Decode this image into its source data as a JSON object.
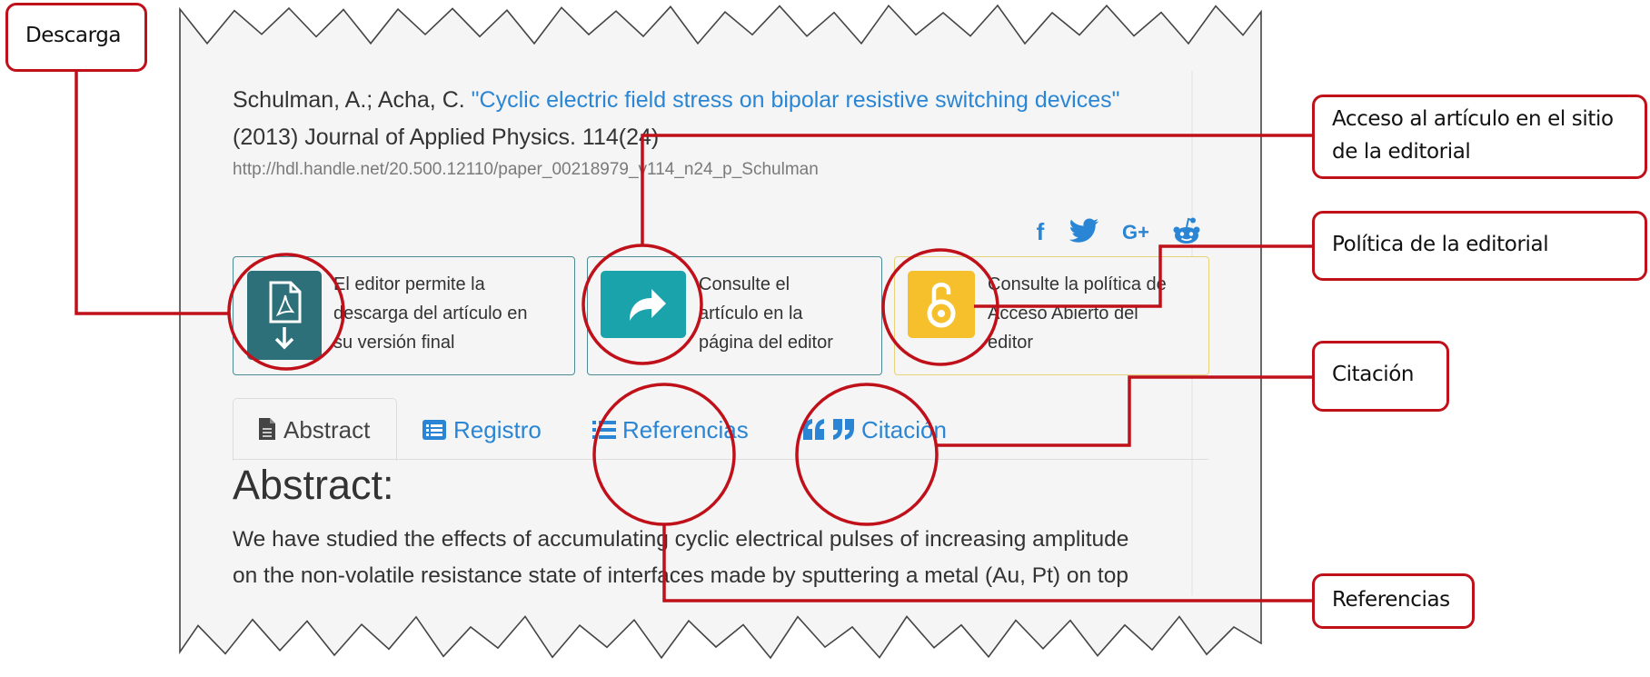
{
  "citation": {
    "authors": "Schulman, A.; Acha, C.",
    "title": "\"Cyclic electric field stress on bipolar resistive switching devices\"",
    "journal": "(2013) Journal of Applied Physics. 114(24)",
    "url": "http://hdl.handle.net/20.500.12110/paper_00218979_v114_n24_p_Schulman"
  },
  "social": {
    "facebook": "f",
    "twitter": "🐦",
    "googleplus": "G+",
    "reddit": "reddit"
  },
  "actions": {
    "download": {
      "line1": "El editor permite la",
      "line2": "descarga del artículo en",
      "line3": "su versión final",
      "icon": "pdf-download-icon",
      "color": "#2e7079"
    },
    "publisher": {
      "line1": "Consulte el",
      "line2": "artículo en la",
      "line3": "página del editor",
      "icon": "share-arrow-icon",
      "color": "#1ba3ac"
    },
    "policy": {
      "line1": "Consulte la política de",
      "line2": "Acceso Abierto del",
      "line3": "editor",
      "icon": "open-access-icon",
      "color": "#f6c02c"
    }
  },
  "tabs": [
    {
      "label": "Abstract",
      "icon": "file-icon"
    },
    {
      "label": "Registro",
      "icon": "list-alt-icon"
    },
    {
      "label": "Referencias",
      "icon": "list-icon"
    },
    {
      "label": "Citación",
      "icon": "quote-icon"
    }
  ],
  "abstract": {
    "heading": "Abstract:",
    "line1": "We have studied the effects of accumulating cyclic electrical pulses of increasing amplitude",
    "line2": "on the non-volatile resistance state of interfaces made by sputtering a metal (Au, Pt) on top"
  },
  "callouts": {
    "descarga": "Descarga",
    "acceso_line1": "Acceso al artículo en el sitio",
    "acceso_line2": "de la editorial",
    "politica": "Política de la editorial",
    "citacion": "Citación",
    "referencias": "Referencias"
  },
  "colors": {
    "callout_red": "#c0101a",
    "link_blue": "#2a86d4"
  }
}
